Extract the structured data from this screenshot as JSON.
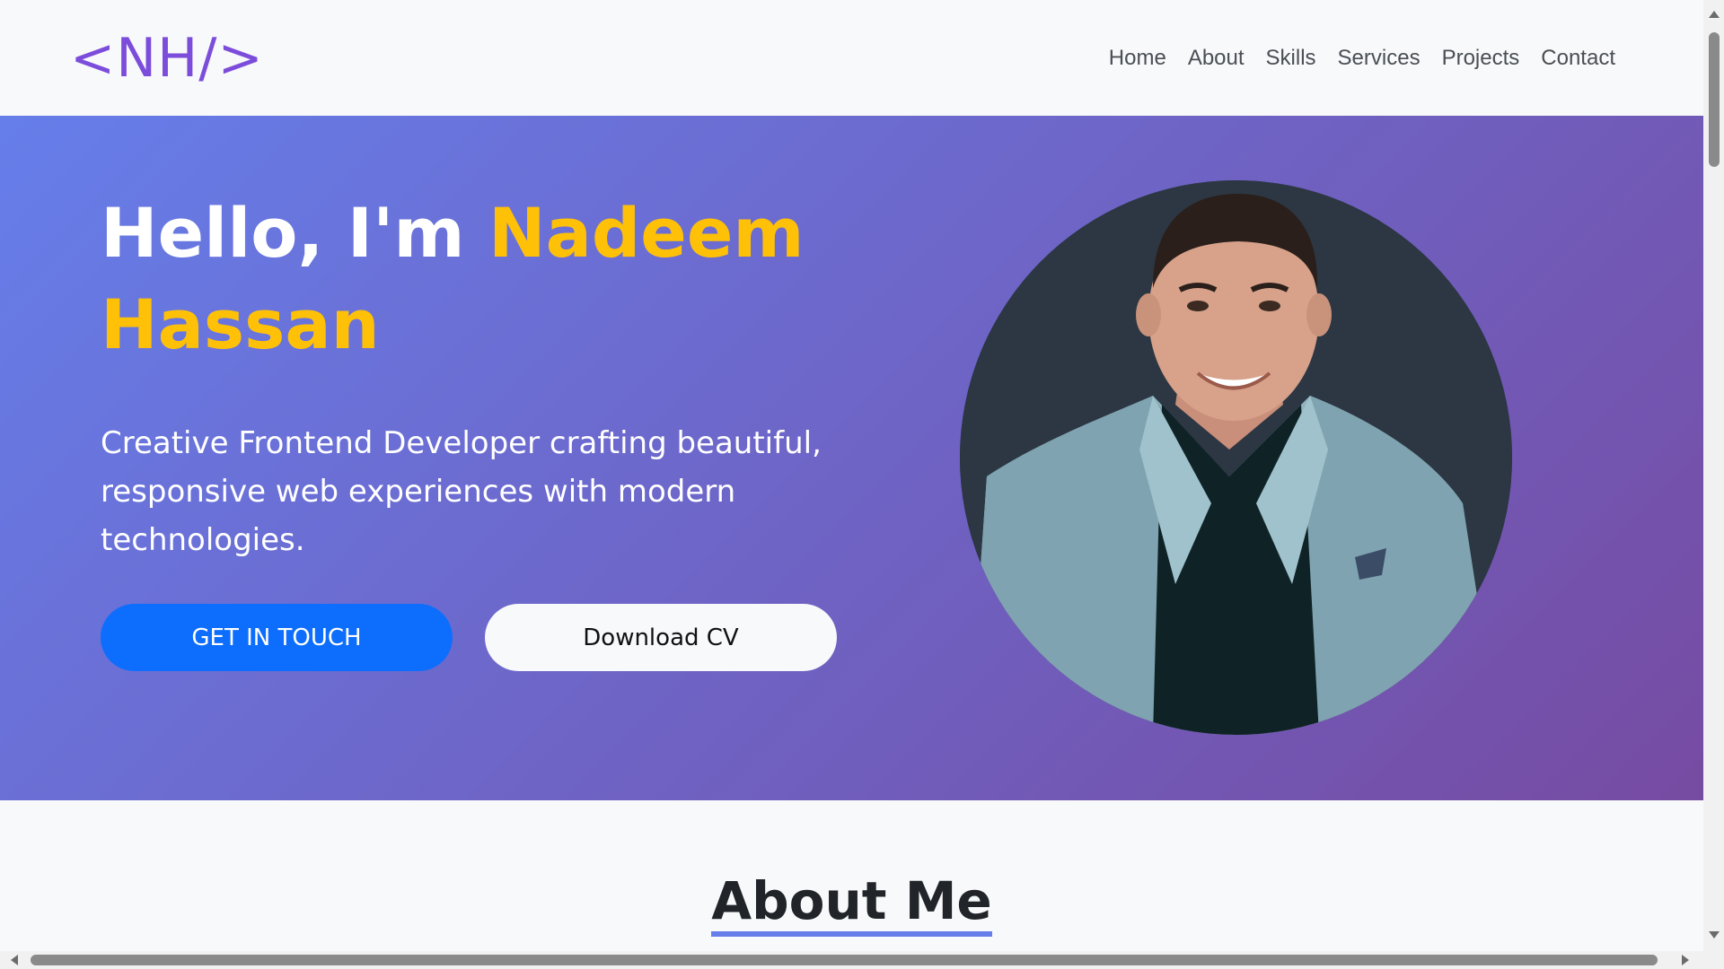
{
  "navbar": {
    "brand": "<NH/>",
    "links": [
      {
        "label": "Home"
      },
      {
        "label": "About"
      },
      {
        "label": "Skills"
      },
      {
        "label": "Services"
      },
      {
        "label": "Projects"
      },
      {
        "label": "Contact"
      }
    ]
  },
  "hero": {
    "greeting": "Hello, I'm ",
    "name": "Nadeem Hassan",
    "subtitle": "Creative Frontend Developer crafting beautiful, responsive web experiences with modern technologies.",
    "primary_button": "GET IN TOUCH",
    "secondary_button": "Download CV",
    "portrait_icon": "profile-photo-icon"
  },
  "about": {
    "title": "About Me"
  },
  "colors": {
    "brand": "#7c4ddb",
    "gradient_start": "#667eea",
    "gradient_end": "#764ba2",
    "accent_name": "#ffc107",
    "primary_button": "#0d6efd"
  }
}
